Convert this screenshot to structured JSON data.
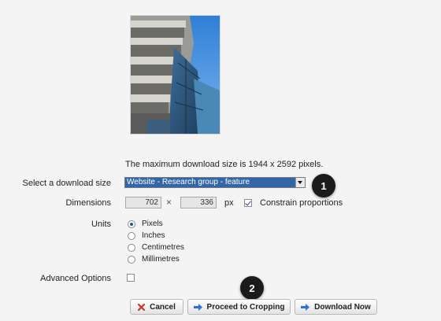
{
  "image": {
    "alt": "building photo",
    "icon": "building-photo"
  },
  "info": {
    "max_size_text": "The maximum download size is 1944 x 2592 pixels."
  },
  "form": {
    "download_size_label": "Select a download size",
    "download_size_value": "Website - Research group - feature",
    "dimensions_label": "Dimensions",
    "width": "702",
    "times": "×",
    "height": "336",
    "unit_suffix": "px",
    "constrain_label": "Constrain proportions",
    "constrain_checked": true,
    "units_label": "Units",
    "units": [
      "Pixels",
      "Inches",
      "Centimetres",
      "Millimetres"
    ],
    "units_selected": "Pixels",
    "advanced_label": "Advanced Options",
    "advanced_checked": false
  },
  "buttons": {
    "cancel": "Cancel",
    "crop": "Proceed to Cropping",
    "download": "Download Now"
  },
  "callouts": {
    "one": "1",
    "two": "2"
  },
  "colors": {
    "selection": "#3366a8",
    "callout": "#1b1b1b",
    "arrow": "#2f6fd8",
    "cancel_x": "#c0392b"
  }
}
